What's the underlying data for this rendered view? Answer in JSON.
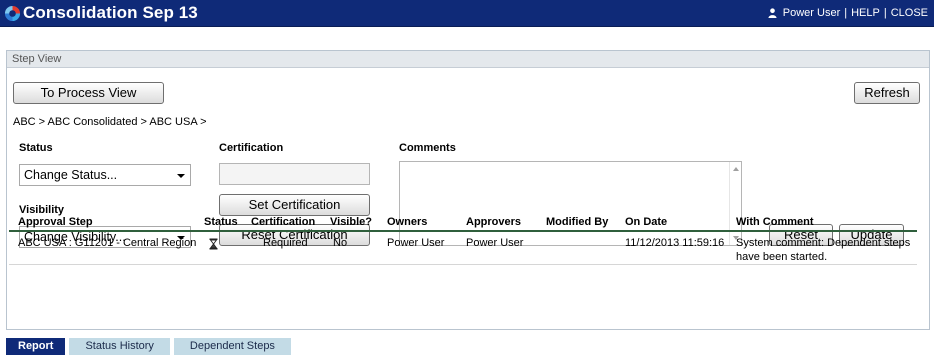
{
  "app": {
    "title": "Consolidation Sep 13",
    "user": "Power User",
    "help": "HELP",
    "close": "CLOSE",
    "separator": "|"
  },
  "panel": {
    "title": "Step View"
  },
  "toolbar": {
    "process_view_label": "To Process View",
    "refresh_label": "Refresh"
  },
  "breadcrumb": "ABC > ABC Consolidated > ABC USA >",
  "form": {
    "status_label": "Status",
    "status_value": "Change Status...",
    "visibility_label": "Visibility",
    "visibility_value": "Change Visibility...",
    "certification_label": "Certification",
    "certification_value": "",
    "set_certification_label": "Set Certification",
    "reset_certification_label": "Reset Certification",
    "comments_label": "Comments",
    "comments_value": "",
    "reset_label": "Reset",
    "update_label": "Update"
  },
  "table": {
    "columns": [
      "Approval Step",
      "Status",
      "Certification",
      "Visible?",
      "Owners",
      "Approvers",
      "Modified By",
      "On Date",
      "With Comment"
    ],
    "rows": [
      {
        "approval_step": "ABC USA : G11201 - Central Region",
        "status_icon": "hourglass-icon",
        "certification": "Required",
        "visible": "No",
        "owners": "Power User",
        "approvers": "Power User",
        "modified_by": "",
        "on_date": "11/12/2013 11:59:16",
        "with_comment": "System comment: Dependent steps have been started."
      }
    ]
  },
  "tabs": [
    "Report",
    "Status History",
    "Dependent Steps"
  ],
  "colors": {
    "header_bg": "#0f2a78",
    "tab_inactive": "#c3dbe6",
    "grid_rule": "#2f5f3c"
  }
}
